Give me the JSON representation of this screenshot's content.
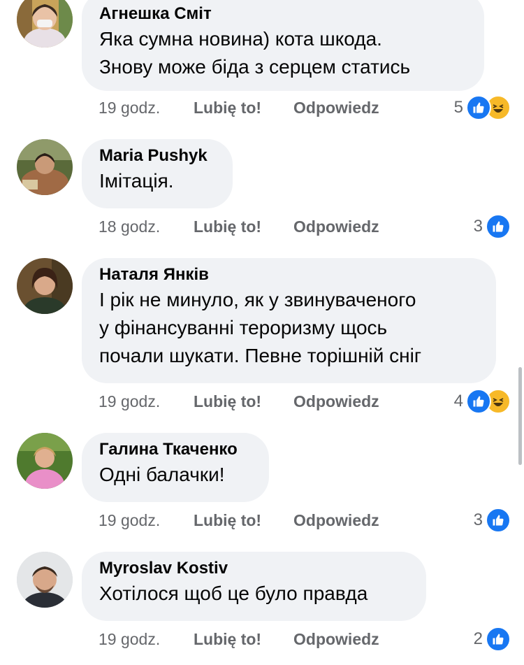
{
  "actions": {
    "like": "Lubię to!",
    "reply": "Odpowiedz"
  },
  "comments": [
    {
      "author": "Агнешка Сміт",
      "text": "Яка сумна новина) кота шкода.\nЗнову може біда з серцем статись",
      "time": "19 godz.",
      "reaction_count": "5",
      "reactions": [
        "like-icon",
        "haha-icon"
      ]
    },
    {
      "author": "Maria Pushyk",
      "text": "Імітація.",
      "time": "18 godz.",
      "reaction_count": "3",
      "reactions": [
        "like-icon"
      ]
    },
    {
      "author": "Наталя Янків",
      "text": "І рік не минуло, як у звинуваченого\nу фінансуванні тероризму щось\nпочали шукати. Певне торішній сніг",
      "time": "19 godz.",
      "reaction_count": "4",
      "reactions": [
        "like-icon",
        "haha-icon"
      ]
    },
    {
      "author": "Галина Ткаченко",
      "text": "Одні балачки!",
      "time": "19 godz.",
      "reaction_count": "3",
      "reactions": [
        "like-icon"
      ]
    },
    {
      "author": "Myroslav Kostiv",
      "text": "Хотілося щоб це було правда",
      "time": "19 godz.",
      "reaction_count": "2",
      "reactions": [
        "like-icon"
      ]
    }
  ],
  "colors": {
    "bubble": "#f0f2f5",
    "secondary_text": "#65676b",
    "like_blue": "#1877f2",
    "haha_yellow": "#f7b928"
  }
}
